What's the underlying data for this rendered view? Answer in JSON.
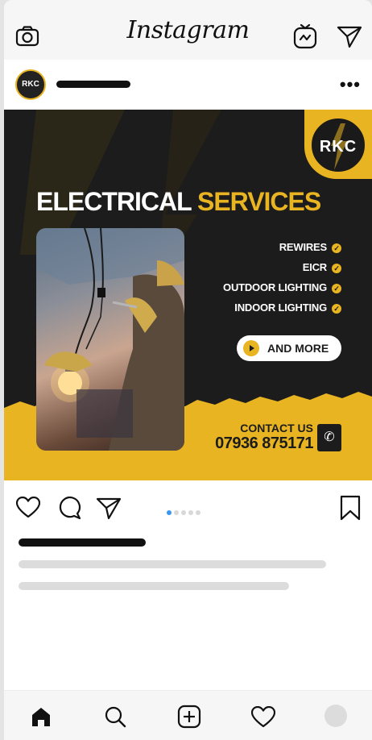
{
  "app": {
    "title": "Instagram"
  },
  "topbar": {
    "icons": [
      "camera-icon",
      "igtv-icon",
      "direct-message-icon"
    ]
  },
  "post_header": {
    "avatar_text": "RKC",
    "more_label": "•••"
  },
  "post": {
    "logo_text": "RKC",
    "headline_part1": "ELECTRICAL",
    "headline_part2": "SERVICES",
    "services": [
      "REWIRES",
      "EICR",
      "OUTDOOR LIGHTING",
      "INDOOR LIGHTING"
    ],
    "check_glyph": "✓",
    "and_more": "AND MORE",
    "contact_label": "CONTACT US",
    "contact_phone": "07936 875171",
    "phone_glyph": "✆",
    "colors": {
      "accent": "#e9b422",
      "dark": "#1c1c1c"
    }
  },
  "carousel": {
    "count": 5,
    "active_index": 0
  },
  "bottom_nav": {
    "items": [
      "home-icon",
      "search-icon",
      "add-post-icon",
      "activity-heart-icon",
      "profile-avatar"
    ]
  }
}
